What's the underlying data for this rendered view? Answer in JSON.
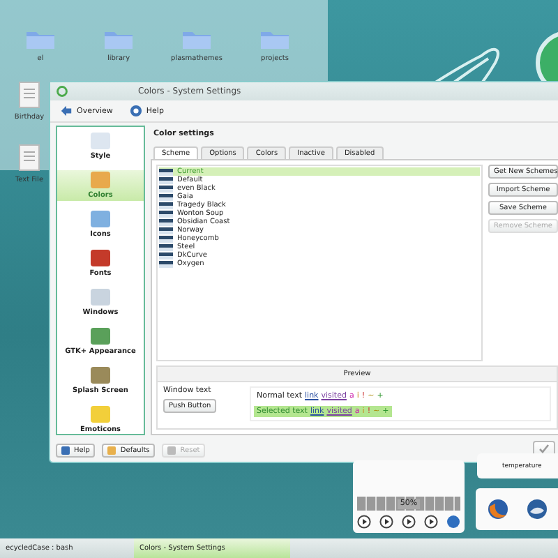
{
  "desktop": {
    "folders": [
      {
        "label": "el"
      },
      {
        "label": "library"
      },
      {
        "label": "plasmathemes"
      },
      {
        "label": "projects"
      }
    ],
    "files": [
      {
        "label": "Birthday"
      },
      {
        "label": "Text File"
      }
    ]
  },
  "window": {
    "title": "Colors - System Settings",
    "toolbar": [
      {
        "label": "Overview"
      },
      {
        "label": "Help"
      }
    ],
    "sidebar": [
      {
        "label": "Style",
        "selected": false
      },
      {
        "label": "Colors",
        "selected": true
      },
      {
        "label": "Icons",
        "selected": false
      },
      {
        "label": "Fonts",
        "selected": false
      },
      {
        "label": "Windows",
        "selected": false
      },
      {
        "label": "GTK+ Appearance",
        "selected": false
      },
      {
        "label": "Splash Screen",
        "selected": false
      },
      {
        "label": "Emoticons",
        "selected": false
      }
    ],
    "heading": "Color settings",
    "tabs": [
      {
        "label": "Scheme",
        "selected": true
      },
      {
        "label": "Options",
        "selected": false
      },
      {
        "label": "Colors",
        "selected": false
      },
      {
        "label": "Inactive",
        "selected": false
      },
      {
        "label": "Disabled",
        "selected": false
      }
    ],
    "schemes": [
      {
        "name": "Current",
        "selected": true
      },
      {
        "name": "Default",
        "selected": false
      },
      {
        "name": "even Black",
        "selected": false
      },
      {
        "name": "Gaia",
        "selected": false
      },
      {
        "name": "Tragedy Black",
        "selected": false
      },
      {
        "name": "Wonton Soup",
        "selected": false
      },
      {
        "name": "Obsidian Coast",
        "selected": false
      },
      {
        "name": "Norway",
        "selected": false
      },
      {
        "name": "Honeycomb",
        "selected": false
      },
      {
        "name": "Steel",
        "selected": false
      },
      {
        "name": "DkCurve",
        "selected": false
      },
      {
        "name": "Oxygen",
        "selected": false
      }
    ],
    "scheme_buttons": [
      {
        "label": "Get New Schemes",
        "disabled": false
      },
      {
        "label": "Import Scheme",
        "disabled": false
      },
      {
        "label": "Save Scheme",
        "disabled": false
      },
      {
        "label": "Remove Scheme",
        "disabled": true
      }
    ],
    "preview": {
      "title": "Preview",
      "window_text": "Window text",
      "push_button": "Push Button",
      "rows": [
        {
          "text": "Normal text",
          "link": "link",
          "visited": "visited",
          "marks": [
            "a",
            "i",
            "!",
            "~",
            "+"
          ],
          "selected": false
        },
        {
          "text": "Selected text",
          "link": "link",
          "visited": "visited",
          "marks": [
            "a",
            "i",
            "!",
            "~",
            "+"
          ],
          "selected": true
        }
      ]
    },
    "buttons": [
      {
        "label": "Help",
        "disabled": false
      },
      {
        "label": "Defaults",
        "disabled": false
      },
      {
        "label": "Reset",
        "disabled": true
      }
    ]
  },
  "widgets": {
    "temperature": "temperature",
    "media_reading": "50%"
  },
  "taskbar": [
    {
      "label": "ecycledCase : bash",
      "selected": false
    },
    {
      "label": "Colors - System Settings",
      "selected": true
    }
  ]
}
